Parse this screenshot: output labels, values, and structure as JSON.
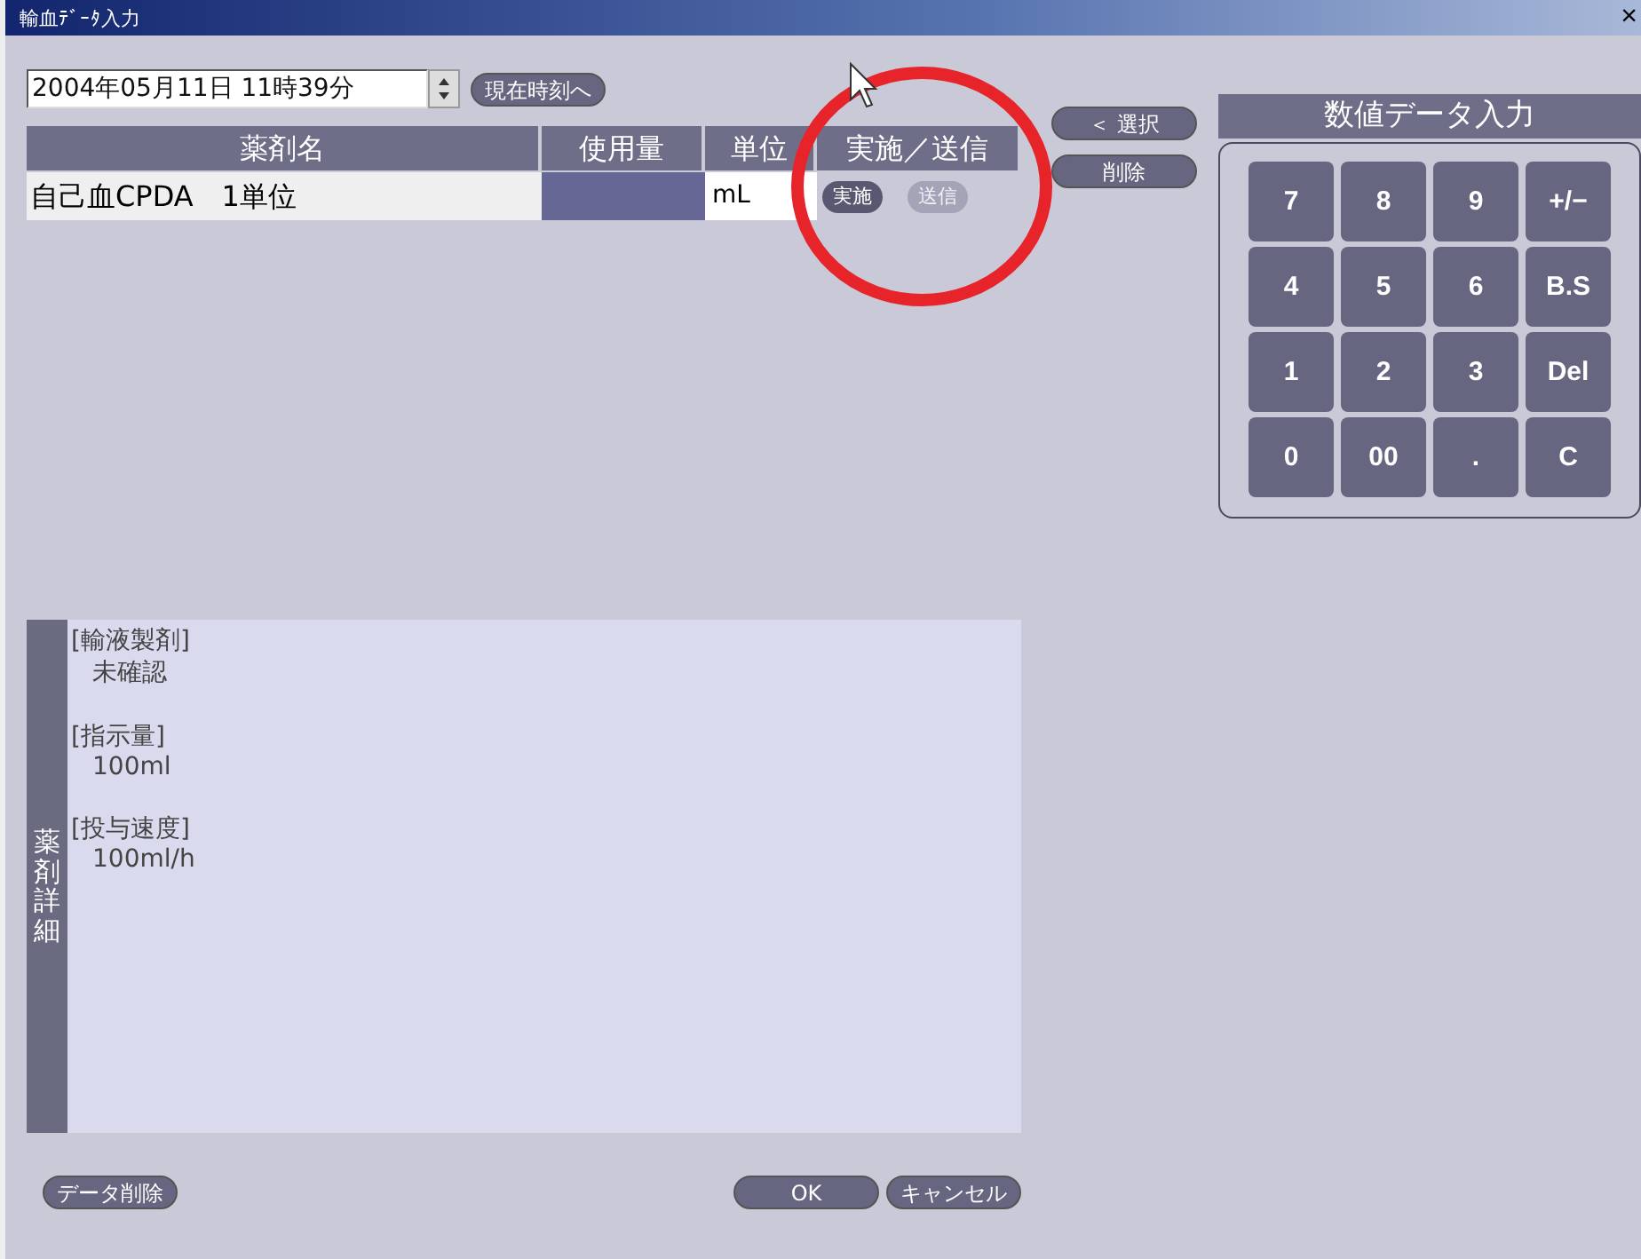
{
  "window": {
    "title": "輸血ﾃﾞｰﾀ入力",
    "close": "×"
  },
  "datetime": {
    "value": "2004年05月11日 11時39分",
    "now_button": "現在時刻へ"
  },
  "table": {
    "columns": [
      "薬剤名",
      "使用量",
      "単位",
      "実施／送信"
    ],
    "rows": [
      {
        "drug": "自己血CPDA　1単位",
        "amount": "",
        "unit": "mL",
        "actions": [
          {
            "label": "実施",
            "disabled": false
          },
          {
            "label": "送信",
            "disabled": true
          }
        ]
      }
    ]
  },
  "side_buttons": [
    "＜ 選択",
    "削除"
  ],
  "detail": {
    "label": "薬剤詳細",
    "sections": [
      {
        "heading": "[輸液製剤]",
        "value": "未確認"
      },
      {
        "heading": "[指示量]",
        "value": "100ml"
      },
      {
        "heading": "[投与速度]",
        "value": "100ml/h"
      }
    ]
  },
  "keypad": {
    "title": "数値データ入力",
    "keys": [
      "7",
      "8",
      "9",
      "+/−",
      "4",
      "5",
      "6",
      "B.S",
      "1",
      "2",
      "3",
      "Del",
      "0",
      "00",
      ".",
      "C"
    ]
  },
  "footer": {
    "left": [
      "データ削除"
    ],
    "right": [
      "OK",
      "キャンセル"
    ]
  }
}
